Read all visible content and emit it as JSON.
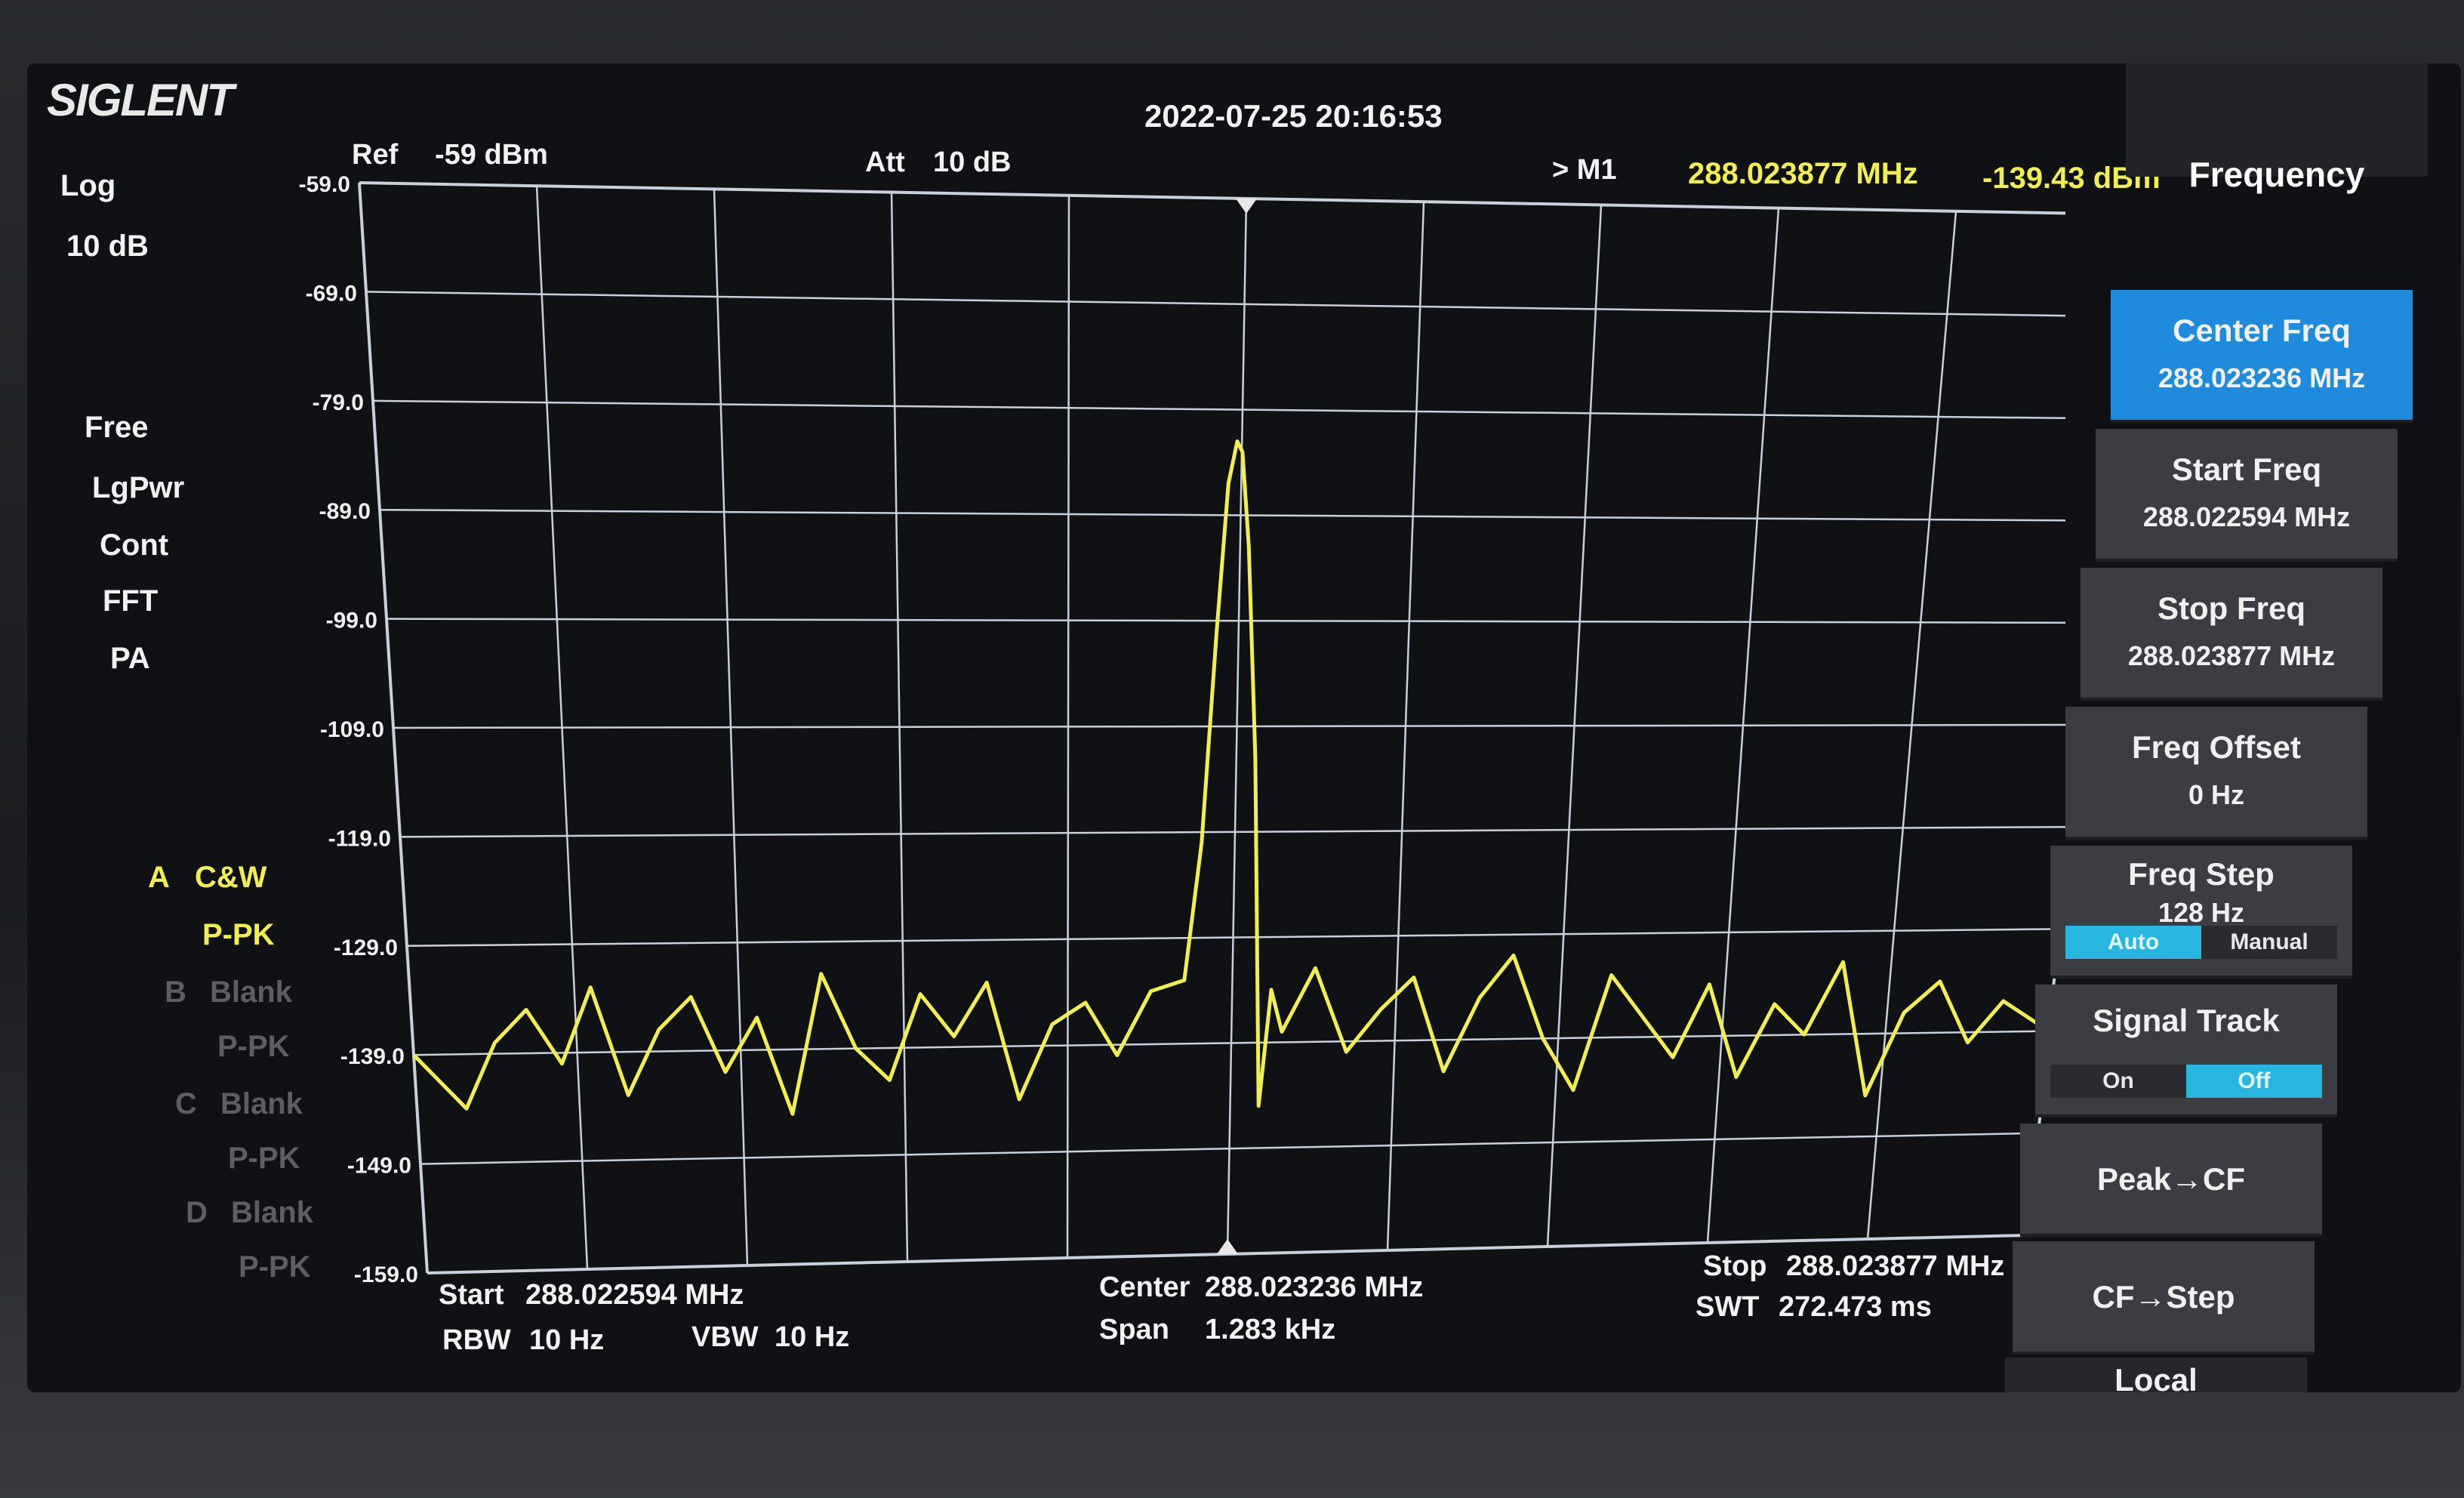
{
  "app": {
    "logo": "SIGLENT",
    "datetime": "2022-07-25 20:16:53"
  },
  "header": {
    "ref_label": "Ref",
    "ref_value": "-59 dBm",
    "att_label": "Att",
    "att_value": "10 dB",
    "marker_label": "> M1",
    "marker_freq": "288.023877 MHz",
    "marker_amp": "-139.43 dBm"
  },
  "left_status": {
    "scale_type": "Log",
    "scale_div": "10 dB",
    "trigger": "Free",
    "detector": "LgPwr",
    "sweep": "Cont",
    "mode": "FFT",
    "pa": "PA",
    "trace_a_label": "A",
    "trace_a_type": "C&W",
    "trace_a_det": "P-PK",
    "trace_b_label": "B",
    "trace_b_type": "Blank",
    "trace_b_det": "P-PK",
    "trace_c_label": "C",
    "trace_c_type": "Blank",
    "trace_c_det": "P-PK",
    "trace_d_label": "D",
    "trace_d_type": "Blank",
    "trace_d_det": "P-PK"
  },
  "footer": {
    "start_label": "Start",
    "start_value": "288.022594 MHz",
    "center_label": "Center",
    "center_value": "288.023236 MHz",
    "stop_label": "Stop",
    "stop_value": "288.023877 MHz",
    "rbw_label": "RBW",
    "rbw_value": "10 Hz",
    "vbw_label": "VBW",
    "vbw_value": "10 Hz",
    "span_label": "Span",
    "span_value": "1.283 kHz",
    "swt_label": "SWT",
    "swt_value": "272.473 ms"
  },
  "menu": {
    "title": "Frequency",
    "center_freq_label": "Center Freq",
    "center_freq_value": "288.023236 MHz",
    "start_freq_label": "Start Freq",
    "start_freq_value": "288.022594 MHz",
    "stop_freq_label": "Stop Freq",
    "stop_freq_value": "288.023877 MHz",
    "freq_offset_label": "Freq Offset",
    "freq_offset_value": "0 Hz",
    "freq_step_label": "Freq Step",
    "freq_step_value": "128 Hz",
    "freq_step_auto": "Auto",
    "freq_step_manual": "Manual",
    "signal_track_label": "Signal Track",
    "signal_track_on": "On",
    "signal_track_off": "Off",
    "peak_cf_label": "Peak→CF",
    "cf_step_label": "CF→Step",
    "local_label": "Local"
  },
  "colors": {
    "trace": "#f2ee52",
    "grid": "#c8d0dc",
    "accent": "#1e8bdd",
    "toggle": "#26b6df"
  },
  "chart_data": {
    "type": "line",
    "title": "",
    "xlabel": "",
    "ylabel": "",
    "ylim": [
      -159.0,
      -59.0
    ],
    "y_ticks": [
      "-59.0",
      "-69.0",
      "-79.0",
      "-89.0",
      "-99.0",
      "-109.0",
      "-119.0",
      "-129.0",
      "-139.0",
      "-149.0",
      "-159.0"
    ],
    "x_range_mhz": [
      288.022594,
      288.023877
    ],
    "marker": {
      "name": "M1",
      "x": 288.023877,
      "y": -139.43
    },
    "series": [
      {
        "x": [
          288.022594,
          288.022633,
          288.022658,
          288.022684,
          288.02271,
          288.022735,
          288.022761,
          288.022787,
          288.022813,
          288.022838,
          288.022864,
          288.02289,
          288.022915,
          288.022941,
          288.022967,
          288.022992,
          288.023018,
          288.023044,
          288.023069,
          288.023095,
          288.023121,
          288.023146,
          288.023172,
          288.023198,
          288.02321,
          288.023219,
          288.023226,
          288.023232,
          288.023236,
          288.023242,
          288.02325,
          288.023258,
          288.023266,
          288.023275,
          288.0233,
          288.023326,
          288.023352,
          288.023377,
          288.023403,
          288.023429,
          288.023454,
          288.02348,
          288.023506,
          288.023531,
          288.023557,
          288.023583,
          288.023608,
          288.023634,
          288.02366,
          288.023685,
          288.023711,
          288.023737,
          288.023762,
          288.023788,
          288.023814,
          288.023839,
          288.023877
        ],
        "y": [
          -139,
          -144,
          -138,
          -135,
          -140,
          -133,
          -143,
          -137,
          -134,
          -141,
          -136,
          -145,
          -132,
          -139,
          -142,
          -134,
          -138,
          -133,
          -144,
          -137,
          -135,
          -140,
          -134,
          -133,
          -120,
          -100,
          -86,
          -82,
          -83,
          -92,
          -112,
          -145,
          -134,
          -138,
          -132,
          -140,
          -136,
          -133,
          -142,
          -135,
          -131,
          -139,
          -144,
          -133,
          -137,
          -141,
          -134,
          -143,
          -136,
          -139,
          -132,
          -145,
          -137,
          -134,
          -140,
          -136,
          -139
        ]
      }
    ]
  }
}
